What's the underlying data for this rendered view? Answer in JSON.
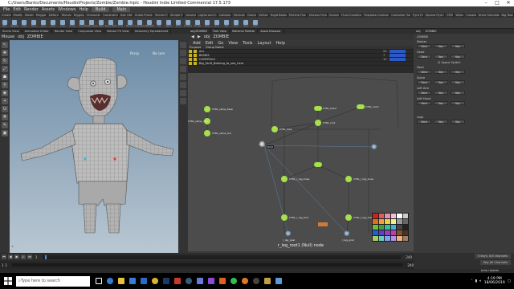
{
  "window": {
    "title": "C:/Users/Banks/Documents/HoudiniProjects/Zombie/Zombie.hiplc - Houdini Indie Limited-Commercial 17.5.173"
  },
  "menu": {
    "items": [
      "File",
      "Edit",
      "Render",
      "Assets",
      "Windows",
      "Help"
    ],
    "build": "Build",
    "main": "Main"
  },
  "shelf_tabs": [
    "Create",
    "Modify",
    "Model",
    "Polygon",
    "Deform",
    "Texture",
    "Rigging",
    "Characters",
    "Constraints",
    "Hair Utils",
    "Guide Process",
    "Terrain FX",
    "Simple FX",
    "Volume",
    "Lights and C...",
    "Collisions",
    "Particles",
    "Grains",
    "Vellum",
    "Rigid Bodies",
    "Particle Fluids",
    "Viscous Fluids",
    "Oceans",
    "Fluid Containers",
    "Populate Containers",
    "Container Tools",
    "Pyro FX",
    "Sparse Pyro FX",
    "FEM",
    "Wires",
    "Crowds",
    "Drive Simulation",
    "Big Tools"
  ],
  "shelf_tools": [
    "Box",
    "Sphere",
    "Tube",
    "Torus",
    "Grid",
    "Null",
    "Line",
    "Circle",
    "Curve",
    "Draw Curve",
    "Path",
    "Spray Paint",
    "Font",
    "Platonic",
    "L-System",
    "Metaball",
    "File",
    "Spiral",
    "Helix",
    "Control",
    "Nurbs",
    "Blob",
    "Sun",
    "Sky",
    "Null",
    "Geo",
    "Cam"
  ],
  "viewport_tabs": [
    "Scene View",
    "Animation Editor",
    "Render View",
    "Composite View",
    "Motion FX View",
    "Geometry Spreadsheet"
  ],
  "viewport_toolbar": {
    "mode": "Mouse",
    "path": "obj",
    "node": "ZOMBIE",
    "view": "Persp",
    "cam": "No cam"
  },
  "network_tabs": [
    "obj/ZOMBIE",
    "Tree View",
    "Material Palette",
    "Asset Browser"
  ],
  "network_path": {
    "root": "obj",
    "node": "ZOMBIE"
  },
  "network_menu": [
    "Add",
    "Edit",
    "Go",
    "View",
    "Tools",
    "Layout",
    "Help"
  ],
  "groups": {
    "header": {
      "col1": "Purpose",
      "col2": "Group Name"
    },
    "rows": [
      {
        "name": "ALL",
        "count": "24"
      },
      {
        "name": "BONES",
        "count": "7"
      },
      {
        "name": "CONTROLS",
        "count": "12"
      },
      {
        "name": "Big_Stuff_Nothing_to_see_here",
        "count": ""
      }
    ]
  },
  "nodes": [
    {
      "label": "CTRL_spine_base"
    },
    {
      "label": "CTRL_spine_mid"
    },
    {
      "label": "CTRL_spine_top"
    },
    {
      "label": "CTRL_head"
    },
    {
      "label": "CTRL_neck"
    },
    {
      "label": "CTRL_root"
    },
    {
      "label": "CTRL_l_leg_knee"
    },
    {
      "label": "CTRL_r_leg_knee"
    },
    {
      "label": "CTRL_l_leg_foot"
    },
    {
      "label": "CTRL_r_leg_foot"
    },
    {
      "label": "Root"
    },
    {
      "label": "r_leg_goal"
    },
    {
      "label": "l_leg_goal"
    },
    {
      "label": "l_leg_goal"
    },
    {
      "label": "CTRL_hips"
    }
  ],
  "node_caption": "r_leg_root1 (Null) node",
  "rig_panel": {
    "tabs": [
      "obj",
      "ZOMBIE"
    ],
    "node_name": "ZOMBIE",
    "sections": [
      {
        "title": "Master",
        "buttons": [
          "Zero",
          "Key",
          "Key"
        ]
      },
      {
        "title": "Head",
        "buttons": [
          "Zero",
          "Key",
          "Key"
        ]
      },
      {
        "title": "Neck",
        "buttons": [
          "Zero",
          "Key",
          "Key"
        ]
      },
      {
        "title": "Spine",
        "buttons": [
          "Zero",
          "Key",
          "Key"
        ]
      },
      {
        "title": "Left Arm",
        "buttons": [
          "Zero",
          "Key",
          "Key"
        ]
      },
      {
        "title": "Left Hand",
        "buttons": [
          "Zero",
          "Key",
          "Key"
        ]
      },
      {
        "title": "Legs",
        "buttons": [
          "Zero",
          "Key",
          "Key"
        ]
      }
    ],
    "toggle": "Space Switch"
  },
  "timeline": {
    "frame": "1",
    "start": "1",
    "end": "240",
    "end2": "240",
    "current_label": "1"
  },
  "keys": {
    "a": "0 keys, 0/0 channels",
    "b": "Key All Channels",
    "c": "Auto Update"
  },
  "taskbar": {
    "search_placeholder": "Type here to search",
    "time": "4:19 PM",
    "date": "18/06/2019"
  },
  "colors": {
    "accent": "#c8b420",
    "node": "#a6e04a",
    "group_blue": "#2e58c2"
  }
}
